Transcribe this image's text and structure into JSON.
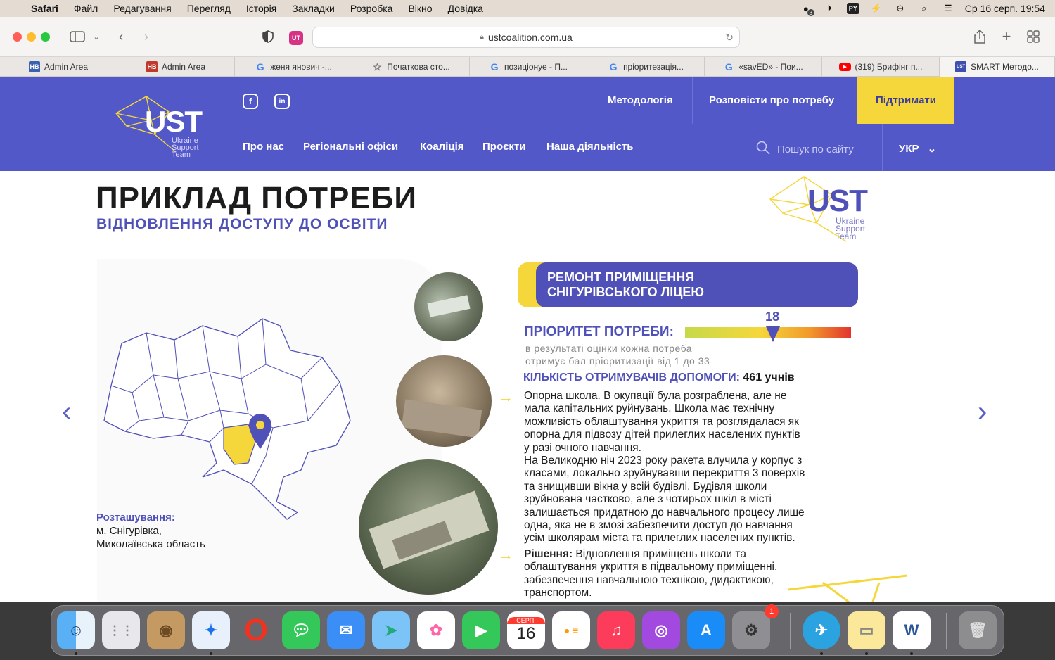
{
  "menubar": {
    "items": [
      "Safari",
      "Файл",
      "Редагування",
      "Перегляд",
      "Історія",
      "Закладки",
      "Розробка",
      "Вікно",
      "Довідка"
    ],
    "status_badge": "3",
    "datetime": "Ср 16 серп.  19:54"
  },
  "browser": {
    "url": "ustcoalition.com.ua",
    "tabs": [
      {
        "label": "Admin Area",
        "icon": "hb-icon",
        "fav": "HB"
      },
      {
        "label": "Admin Area",
        "icon": "hb-icon",
        "fav": "HB"
      },
      {
        "label": "женя янович -...",
        "icon": "google-icon",
        "fav": "G"
      },
      {
        "label": "Початкова сто...",
        "icon": "star-icon",
        "fav": "☆"
      },
      {
        "label": "позиціонуе - П...",
        "icon": "google-icon",
        "fav": "G"
      },
      {
        "label": "пріоритезація...",
        "icon": "google-icon",
        "fav": "G"
      },
      {
        "label": "«savED» - Пои...",
        "icon": "google-icon",
        "fav": "G"
      },
      {
        "label": "(319) Брифінг п...",
        "icon": "youtube-icon",
        "fav": "▶"
      },
      {
        "label": "SMART Методо...",
        "icon": "ust-icon",
        "fav": "UST"
      }
    ]
  },
  "site": {
    "logo": {
      "mark": "UST",
      "sub": [
        "Ukraine",
        "Support",
        "Team"
      ]
    },
    "social": [
      "f",
      "in"
    ],
    "nav_top": [
      "Методологія",
      "Розповісти про потребу"
    ],
    "support_label": "Підтримати",
    "nav_bottom": [
      "Про нас",
      "Регіональні офіси",
      "Коаліція",
      "Проєкти",
      "Наша діяльність"
    ],
    "search_placeholder": "Пошук по сайту",
    "lang": "УКР"
  },
  "slide": {
    "title": "ПРИКЛАД ПОТРЕБИ",
    "subtitle": "ВІДНОВЛЕННЯ ДОСТУПУ ДО ОСВІТИ",
    "card_title_1": "РЕМОНТ ПРИМІЩЕННЯ",
    "card_title_2": "СНІГУРІВСЬКОГО ЛІЦЕЮ",
    "priority_label": "ПРІОРИТЕТ ПОТРЕБИ:",
    "priority_value": "18",
    "priority_fraction": 0.53,
    "priority_note_1": "в результаті оцінки кожна потреба",
    "priority_note_2": "отримує бал пріоритизації від 1 до 33",
    "recipients_label": "КІЛЬКІСТЬ ОТРИМУВАЧІВ ДОПОМОГИ:",
    "recipients_value": "461 учнів",
    "body": [
      "Опорна школа. В окупації була розграблена, але не",
      "мала капітальних руйнувань. Школа має технічну",
      "можливість облаштування укриття та розглядалася як",
      "опорна для підвозу дітей прилеглих населених пунктів",
      "у разі очного навчання.",
      "На Великодню ніч 2023 року ракета влучила у корпус з",
      "класами, локально зруйнувавши перекриття 3 поверхів",
      "та знищивши вікна у всій будівлі. Будівля школи",
      "зруйнована частково, але з чотирьох шкіл в місті",
      "залишається придатною до навчального процесу лише",
      "одна, яка не в змозі забезпечити доступ до навчання",
      "усім школярам міста та прилеглих населених пунктів."
    ],
    "solution_label": "Рішення:",
    "solution": [
      " Відновлення приміщень школи та",
      "облаштування укриття в підвальному приміщенні,",
      "забезпечення навчальною технікою, дидактикою,",
      "транспортом."
    ],
    "location_label": "Розташування:",
    "location_lines": [
      "м. Снігурівка,",
      "Миколаївська область"
    ],
    "prev": "‹",
    "next": "›"
  },
  "dock": {
    "calendar_month": "СЕРП.",
    "calendar_day": "16",
    "settings_badge": "1"
  }
}
